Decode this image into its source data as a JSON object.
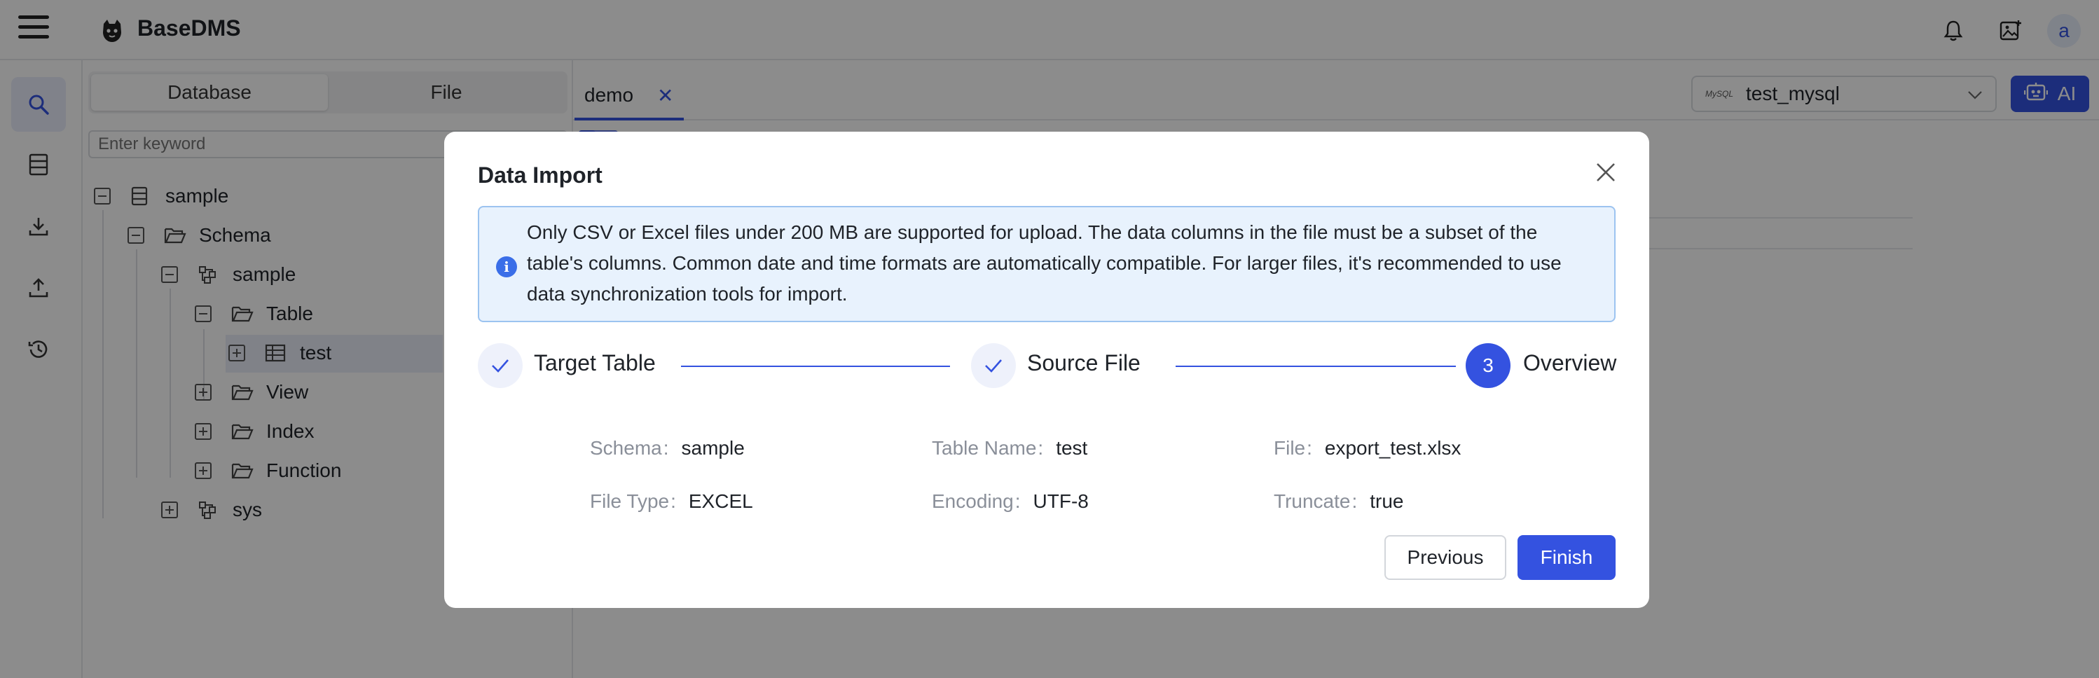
{
  "app": {
    "title": "BaseDMS"
  },
  "left_panel": {
    "segments": [
      {
        "label": "Database"
      },
      {
        "label": "File"
      }
    ],
    "search_placeholder": "Enter keyword",
    "tree": [
      {
        "label": "sample",
        "icon": "database-icon",
        "toggle": "collapse"
      },
      {
        "label": "Schema",
        "icon": "folder-open-icon",
        "toggle": "collapse"
      },
      {
        "label": "sample",
        "icon": "schema-icon",
        "toggle": "collapse"
      },
      {
        "label": "Table",
        "icon": "folder-open-icon",
        "toggle": "collapse"
      },
      {
        "label": "test",
        "icon": "table-icon",
        "toggle": "expand",
        "selected": true
      },
      {
        "label": "View",
        "icon": "folder-open-icon",
        "toggle": "expand"
      },
      {
        "label": "Index",
        "icon": "folder-open-icon",
        "toggle": "expand"
      },
      {
        "label": "Function",
        "icon": "folder-open-icon",
        "toggle": "expand"
      },
      {
        "label": "sys",
        "icon": "schema-icon",
        "toggle": "expand"
      }
    ]
  },
  "editor": {
    "tab_label": "demo",
    "connection": "test_mysql",
    "connection_badge": "MySQL",
    "ai_label": "AI"
  },
  "header": {
    "avatar_letter": "a"
  },
  "modal": {
    "title": "Data Import",
    "notice": "Only CSV or Excel files under 200 MB are supported for upload. The data columns in the file must be a subset of the table's columns. Common date and time formats are automatically compatible. For larger files, it's recommended to use data synchronization tools for import.",
    "steps": [
      {
        "label": "Target Table",
        "status": "done"
      },
      {
        "label": "Source File",
        "status": "done"
      },
      {
        "label": "Overview",
        "status": "current",
        "number": "3"
      }
    ],
    "summary": [
      {
        "key": "Schema",
        "value": "sample"
      },
      {
        "key": "Table Name",
        "value": "test"
      },
      {
        "key": "File",
        "value": "export_test.xlsx"
      },
      {
        "key": "File Type",
        "value": "EXCEL"
      },
      {
        "key": "Encoding",
        "value": "UTF-8"
      },
      {
        "key": "Truncate",
        "value": "true"
      }
    ],
    "previous_label": "Previous",
    "finish_label": "Finish"
  },
  "colors": {
    "primary": "#3452e0",
    "notice_bg": "#e8f2fd",
    "notice_border": "#9cc3f0"
  }
}
